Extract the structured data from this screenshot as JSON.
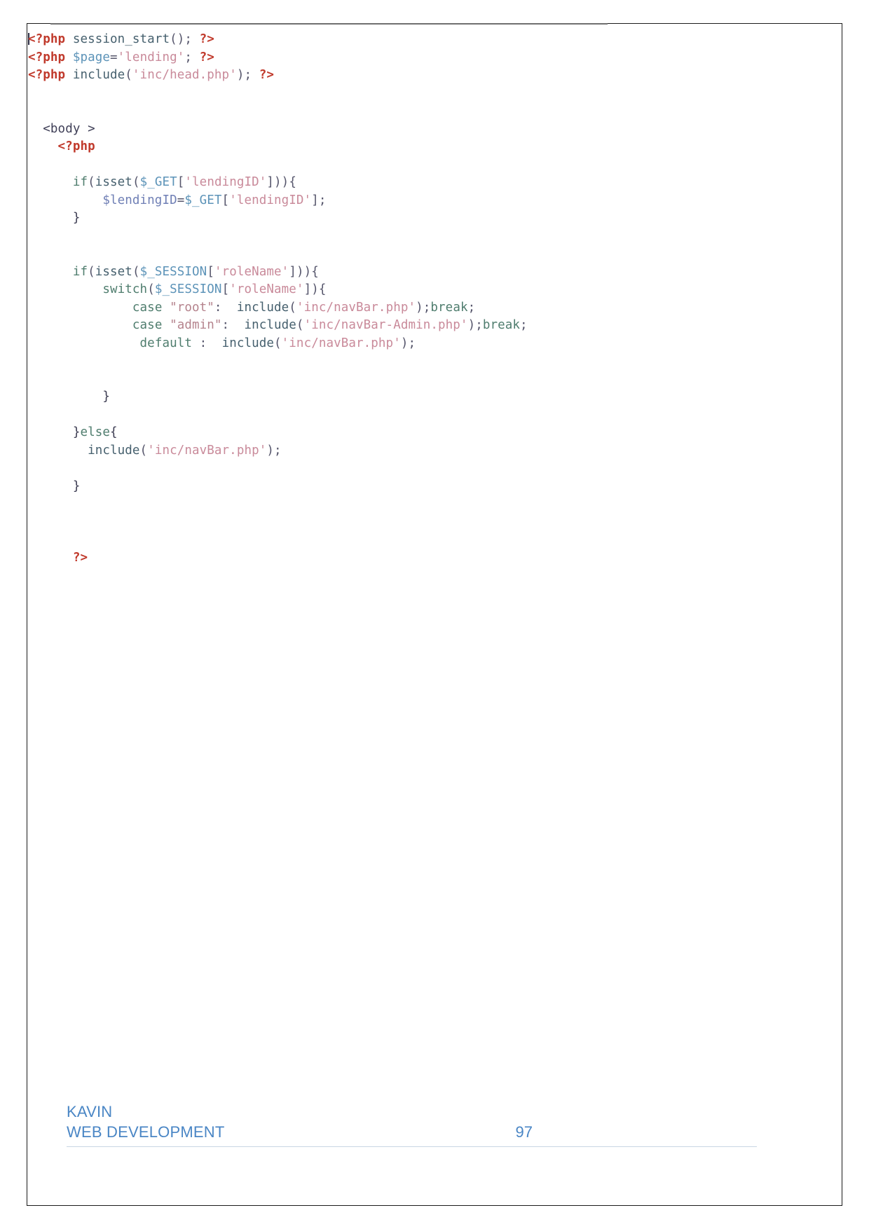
{
  "document": {
    "type": "code-listing-page",
    "page_number": "97"
  },
  "code": {
    "language": "php",
    "lines": [
      {
        "id": "l1",
        "text": "<?php session_start(); ?>"
      },
      {
        "id": "l2",
        "text": "<?php $page='lending'; ?>"
      },
      {
        "id": "l3",
        "text": "<?php include('inc/head.php'); ?>"
      },
      {
        "id": "l4",
        "text": ""
      },
      {
        "id": "l5",
        "text": ""
      },
      {
        "id": "l6",
        "text": "  <body >"
      },
      {
        "id": "l7",
        "text": "    <?php"
      },
      {
        "id": "l8",
        "text": ""
      },
      {
        "id": "l9",
        "text": "      if(isset($_GET['lendingID'])){"
      },
      {
        "id": "l10",
        "text": "          $lendingID=$_GET['lendingID'];"
      },
      {
        "id": "l11",
        "text": "      }"
      },
      {
        "id": "l12",
        "text": ""
      },
      {
        "id": "l13",
        "text": ""
      },
      {
        "id": "l14",
        "text": "      if(isset($_SESSION['roleName'])){"
      },
      {
        "id": "l15",
        "text": "          switch($_SESSION['roleName']){"
      },
      {
        "id": "l16",
        "text": "              case \"root\":  include('inc/navBar.php');break;"
      },
      {
        "id": "l17",
        "text": "              case \"admin\":  include('inc/navBar-Admin.php');break;"
      },
      {
        "id": "l18",
        "text": "               default :  include('inc/navBar.php');"
      },
      {
        "id": "l19",
        "text": ""
      },
      {
        "id": "l20",
        "text": ""
      },
      {
        "id": "l21",
        "text": "          }"
      },
      {
        "id": "l22",
        "text": ""
      },
      {
        "id": "l23",
        "text": "      }else{"
      },
      {
        "id": "l24",
        "text": "        include('inc/navBar.php');"
      },
      {
        "id": "l25",
        "text": ""
      },
      {
        "id": "l26",
        "text": "      }"
      },
      {
        "id": "l27",
        "text": ""
      },
      {
        "id": "l28",
        "text": ""
      },
      {
        "id": "l29",
        "text": ""
      },
      {
        "id": "l30",
        "text": "      ?>"
      }
    ]
  },
  "footer": {
    "author": "KAVIN",
    "subject": "WEB DEVELOPMENT",
    "page_number": "97"
  },
  "colors": {
    "footer_text": "#4a86c5",
    "php_tag": "#c0392b",
    "string": "#c98a9a",
    "keyword": "#4f7d6e",
    "variable": "#5c93b8",
    "page_border": "#1a1a1a"
  }
}
